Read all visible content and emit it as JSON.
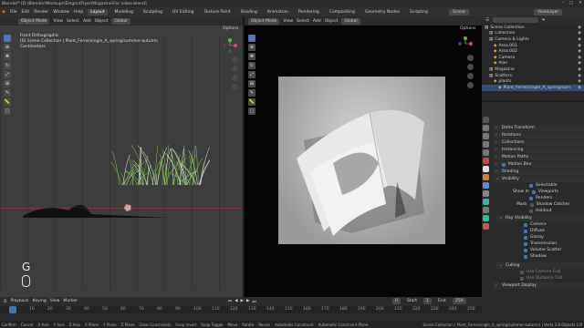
{
  "title_bar": {
    "text": "Blender* [D:\\Blender\\Mockups\\ElegantFlyer\\Magazine\\For video.blend]"
  },
  "menu": {
    "items": [
      "File",
      "Edit",
      "Render",
      "Window",
      "Help"
    ]
  },
  "workspaces": [
    "Layout",
    "Modeling",
    "Sculpting",
    "UV Editing",
    "Texture Paint",
    "Shading",
    "Animation",
    "Rendering",
    "Compositing",
    "Geometry Nodes",
    "Scripting"
  ],
  "header_right": {
    "scene_label": "Scene",
    "view_layer_label": "ViewLayer"
  },
  "left_viewport": {
    "mode_label": "Object Mode",
    "menus": [
      "View",
      "Select",
      "Add",
      "Object"
    ],
    "transform_label": "Global",
    "options_label": "Options",
    "overlay_lines": [
      "Front Orthographic",
      "(0) Scene Collection | Plant_Ferns(single_A_spring/summer-autumn",
      "Centimeters"
    ],
    "key_hint": "G"
  },
  "right_viewport": {
    "options_label": "Options"
  },
  "outliner": {
    "rows": [
      {
        "label": "Scene Collection",
        "depth": 0,
        "sel": false
      },
      {
        "label": "Collection",
        "depth": 1,
        "sel": false
      },
      {
        "label": "Camera & Lights",
        "depth": 1,
        "sel": false
      },
      {
        "label": "Area.001",
        "depth": 2,
        "sel": false
      },
      {
        "label": "Area.002",
        "depth": 2,
        "sel": false
      },
      {
        "label": "Camera",
        "depth": 2,
        "sel": false
      },
      {
        "label": "Plan",
        "depth": 2,
        "sel": false
      },
      {
        "label": "Magazine",
        "depth": 1,
        "sel": false
      },
      {
        "label": "Scatters",
        "depth": 1,
        "sel": false
      },
      {
        "label": "plants",
        "depth": 2,
        "sel": false
      },
      {
        "label": "Plant_Ferns(single_A_spring/sum",
        "depth": 3,
        "sel": true
      }
    ]
  },
  "properties": {
    "panels": [
      "Delta Transform",
      "Relations",
      "Collections",
      "Instancing",
      "Motion Paths",
      "Motion Blur",
      "Shading",
      "Visibility"
    ],
    "visibility": {
      "selectable": "Selectable",
      "show_in": "Show In",
      "viewports": "Viewports",
      "renders": "Renders",
      "mask": "Mask",
      "shadow_catcher": "Shadow Catcher",
      "holdout": "Holdout"
    },
    "ray_visibility_title": "Ray Visibility",
    "ray_items": [
      "Camera",
      "Diffuse",
      "Glossy",
      "Transmission",
      "Volume Scatter",
      "Shadow"
    ],
    "culling_title": "Culling",
    "culling_items": [
      "Use Camera Cull",
      "Use Distance Cull"
    ],
    "viewport_display": "Viewport Display"
  },
  "timeline": {
    "menus": [
      "Playback",
      "Keying",
      "View",
      "Marker"
    ],
    "start_label": "Start",
    "start_value": "1",
    "end_label": "End",
    "end_value": "250",
    "current_frame": "0",
    "ruler": [
      "0",
      "10",
      "20",
      "30",
      "40",
      "50",
      "60",
      "70",
      "80",
      "90",
      "100",
      "110",
      "120",
      "130",
      "140",
      "150",
      "160",
      "170",
      "180",
      "190",
      "200",
      "210",
      "220",
      "230",
      "240",
      "250"
    ]
  },
  "status_bar": {
    "items": [
      "Confirm",
      "Cancel",
      "X Axis",
      "Y Axis",
      "Z Axis",
      "X Plane",
      "Y Plane",
      "Z Plane",
      "Clear Constraints",
      "Snap Invert",
      "Snap Toggle",
      "Move",
      "Rotate",
      "Resize",
      "Automatic Constraint",
      "Automatic Constraint Plane"
    ],
    "right": "Scene Collection | Plant_Ferns(single_A_spring/summer-autumn) | Verts 3.8 Objects 1/9"
  },
  "colors": {
    "accent": "#4772b3",
    "grass_green": "#6fae4a",
    "axis_red": "#c0424f"
  }
}
